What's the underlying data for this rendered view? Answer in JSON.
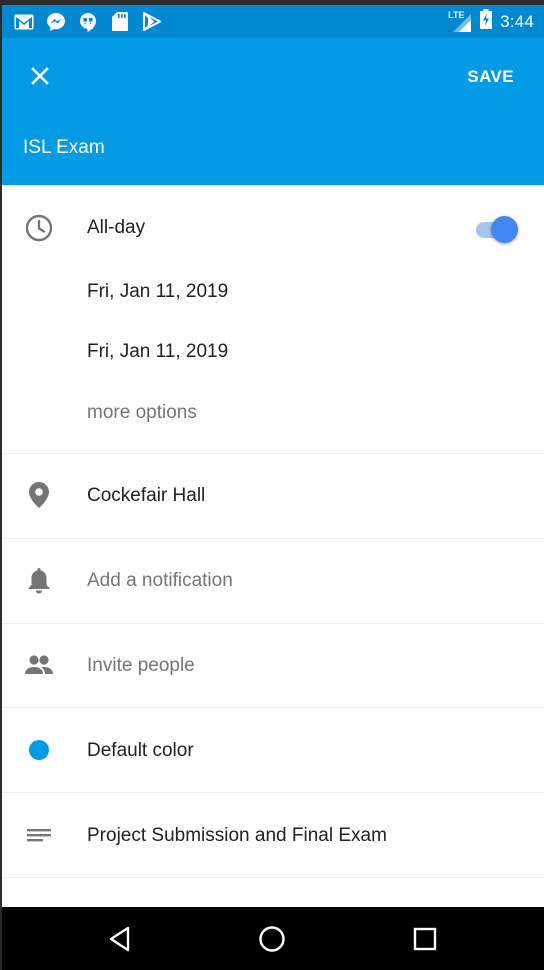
{
  "status_bar": {
    "time": "3:44",
    "network": "LTE",
    "left_icons": [
      "gmail-icon",
      "messenger-icon",
      "hangouts-icon",
      "sd-card-icon",
      "play-store-icon"
    ],
    "right_icons": [
      "lte-signal-icon",
      "battery-charging-icon"
    ]
  },
  "app_bar": {
    "close_icon": "close-icon",
    "save_label": "SAVE",
    "event_title": "ISL Exam",
    "color": "#039be5"
  },
  "form": {
    "all_day": {
      "label": "All-day",
      "enabled": true,
      "icon": "clock-icon"
    },
    "start_date": "Fri, Jan 11, 2019",
    "end_date": "Fri, Jan 11, 2019",
    "more_options": "more options",
    "location": {
      "value": "Cockefair Hall",
      "icon": "location-pin-icon"
    },
    "notification": {
      "placeholder": "Add a notification",
      "icon": "bell-icon"
    },
    "people": {
      "placeholder": "Invite people",
      "icon": "people-icon"
    },
    "color": {
      "label": "Default color",
      "swatch": "#039be5",
      "icon": "color-dot-icon"
    },
    "description": {
      "value": "Project Submission and Final Exam",
      "icon": "notes-icon"
    }
  },
  "nav_bar": {
    "buttons": [
      "back-icon",
      "home-icon",
      "recents-icon"
    ]
  }
}
